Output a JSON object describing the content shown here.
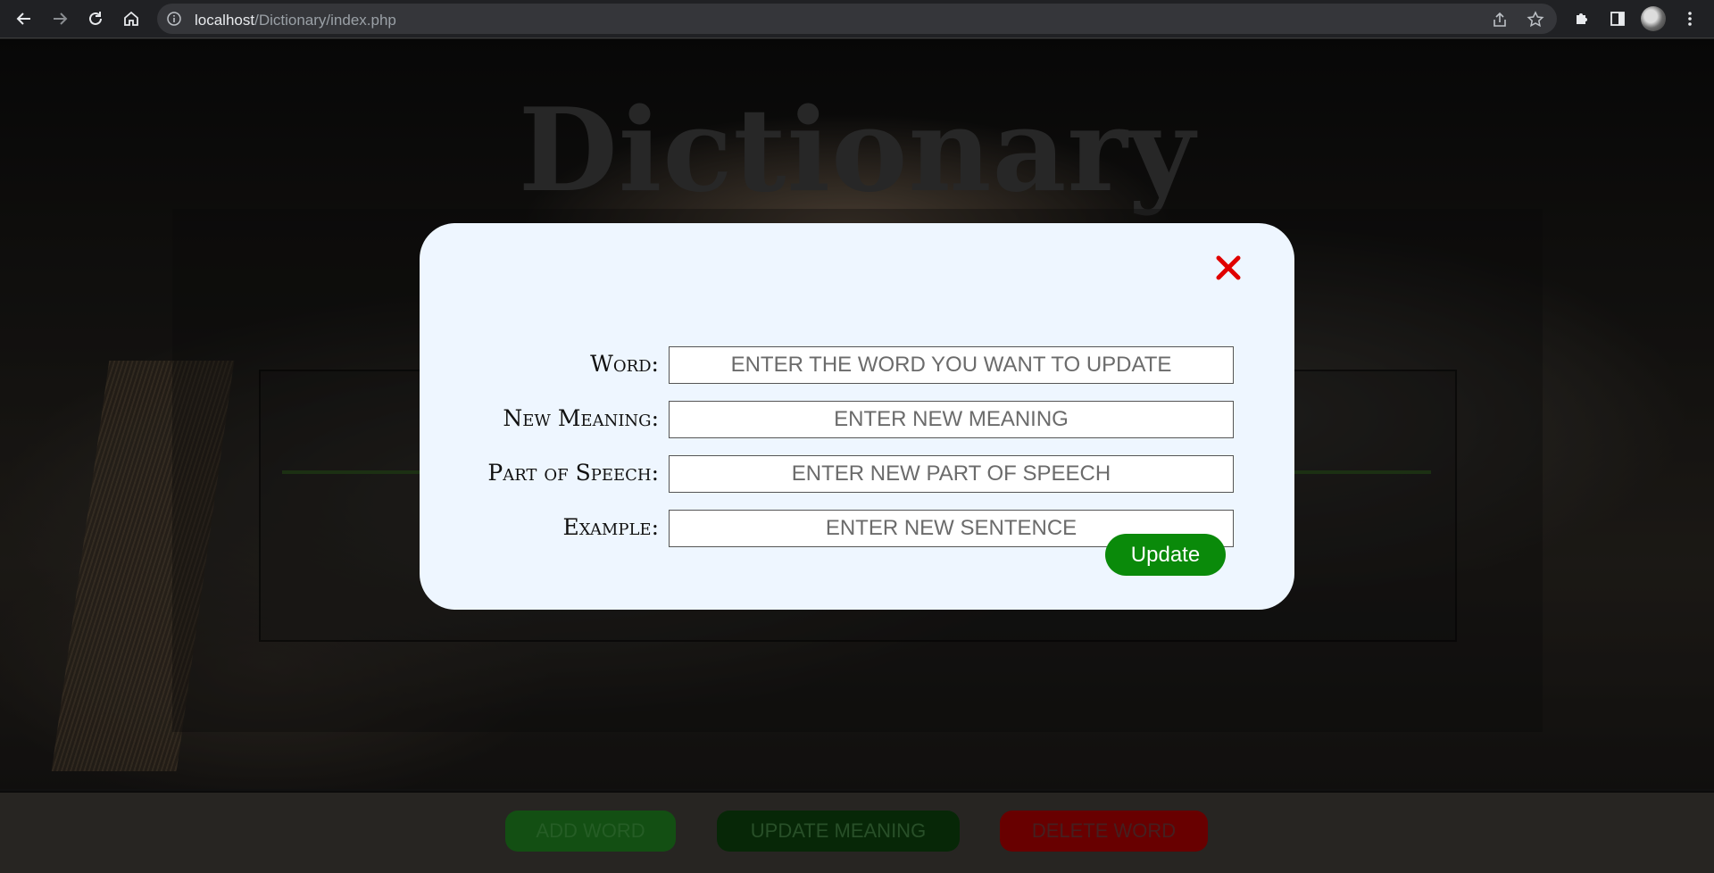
{
  "browser": {
    "url_host": "localhost",
    "url_path": "/Dictionary/index.php"
  },
  "page": {
    "title": "Dictionary",
    "footer_buttons": [
      {
        "label": "ADD WORD",
        "color": "#1e7a1e"
      },
      {
        "label": "UPDATE MEANING",
        "color": "#0c3d0c"
      },
      {
        "label": "DELETE WORD",
        "color": "#a00000"
      }
    ]
  },
  "modal": {
    "fields": [
      {
        "label": "Word:",
        "placeholder": "ENTER THE WORD YOU WANT TO UPDATE",
        "value": ""
      },
      {
        "label": "New Meaning:",
        "placeholder": "ENTER NEW MEANING",
        "value": ""
      },
      {
        "label": "Part of Speech:",
        "placeholder": "ENTER NEW PART OF SPEECH",
        "value": ""
      },
      {
        "label": "Example:",
        "placeholder": "ENTER NEW SENTENCE",
        "value": ""
      }
    ],
    "submit_label": "Update",
    "close_icon": "close-icon",
    "accent_color": "#0a8a0a",
    "close_color": "#e00000"
  }
}
